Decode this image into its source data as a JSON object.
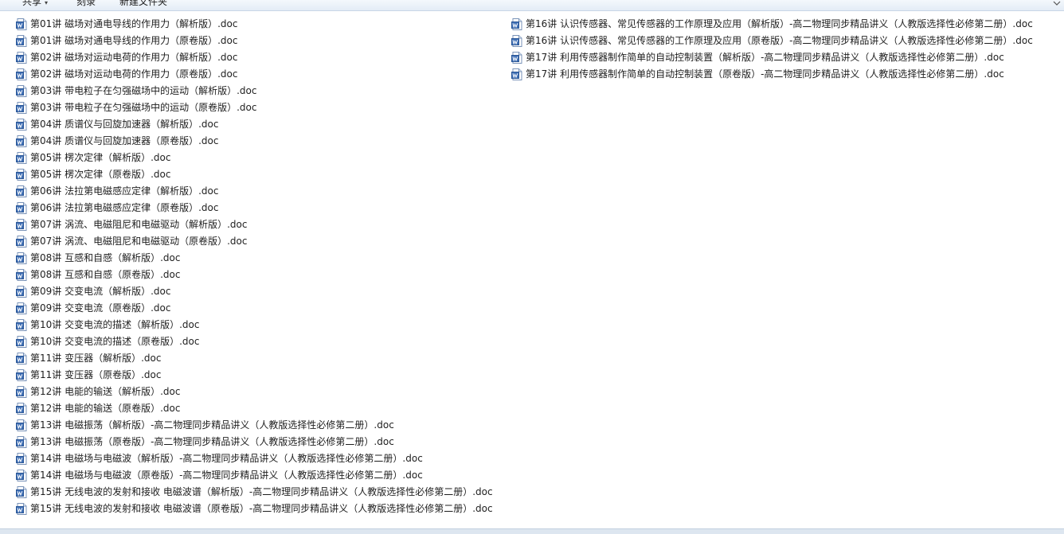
{
  "toolbar": {
    "share_label": "共享",
    "burn_label": "刻录",
    "new_folder_label": "新建文件夹",
    "caret": "▾"
  },
  "icons": {
    "file_icon": "word-document-icon",
    "view_toggle": "chevron-down-icon"
  },
  "colors": {
    "accent_blue": "#2b5797",
    "icon_blue": "#3f6fb5"
  },
  "files": {
    "column1": [
      "第01讲 磁场对通电导线的作用力（解析版）.doc",
      "第01讲 磁场对通电导线的作用力（原卷版）.doc",
      "第02讲 磁场对运动电荷的作用力（解析版）.doc",
      "第02讲 磁场对运动电荷的作用力（原卷版）.doc",
      "第03讲 带电粒子在匀强磁场中的运动（解析版）.doc",
      "第03讲 带电粒子在匀强磁场中的运动（原卷版）.doc",
      "第04讲 质谱仪与回旋加速器（解析版）.doc",
      "第04讲 质谱仪与回旋加速器（原卷版）.doc",
      "第05讲 楞次定律（解析版）.doc",
      "第05讲 楞次定律（原卷版）.doc",
      "第06讲 法拉第电磁感应定律（解析版）.doc",
      "第06讲 法拉第电磁感应定律（原卷版）.doc",
      "第07讲 涡流、电磁阻尼和电磁驱动（解析版）.doc",
      "第07讲 涡流、电磁阻尼和电磁驱动（原卷版）.doc",
      "第08讲 互感和自感（解析版）.doc",
      "第08讲 互感和自感（原卷版）.doc",
      "第09讲 交变电流（解析版）.doc",
      "第09讲 交变电流（原卷版）.doc",
      "第10讲 交变电流的描述（解析版）.doc",
      "第10讲 交变电流的描述（原卷版）.doc",
      "第11讲 变压器（解析版）.doc",
      "第11讲 变压器（原卷版）.doc",
      "第12讲 电能的输送（解析版）.doc",
      "第12讲 电能的输送（原卷版）.doc",
      "第13讲 电磁振荡（解析版）-高二物理同步精品讲义（人教版选择性必修第二册）.doc",
      "第13讲 电磁振荡（原卷版）-高二物理同步精品讲义（人教版选择性必修第二册）.doc",
      "第14讲  电磁场与电磁波（解析版）-高二物理同步精品讲义（人教版选择性必修第二册）.doc",
      "第14讲  电磁场与电磁波（原卷版）-高二物理同步精品讲义（人教版选择性必修第二册）.doc",
      "第15讲 无线电波的发射和接收  电磁波谱（解析版）-高二物理同步精品讲义（人教版选择性必修第二册）.doc",
      "第15讲 无线电波的发射和接收  电磁波谱（原卷版）-高二物理同步精品讲义（人教版选择性必修第二册）.doc"
    ],
    "column2": [
      "第16讲 认识传感器、常见传感器的工作原理及应用（解析版）-高二物理同步精品讲义（人教版选择性必修第二册）.doc",
      "第16讲 认识传感器、常见传感器的工作原理及应用（原卷版）-高二物理同步精品讲义（人教版选择性必修第二册）.doc",
      "第17讲 利用传感器制作简单的自动控制装置（解析版）-高二物理同步精品讲义（人教版选择性必修第二册）.doc",
      "第17讲 利用传感器制作简单的自动控制装置（原卷版）-高二物理同步精品讲义（人教版选择性必修第二册）.doc"
    ]
  }
}
